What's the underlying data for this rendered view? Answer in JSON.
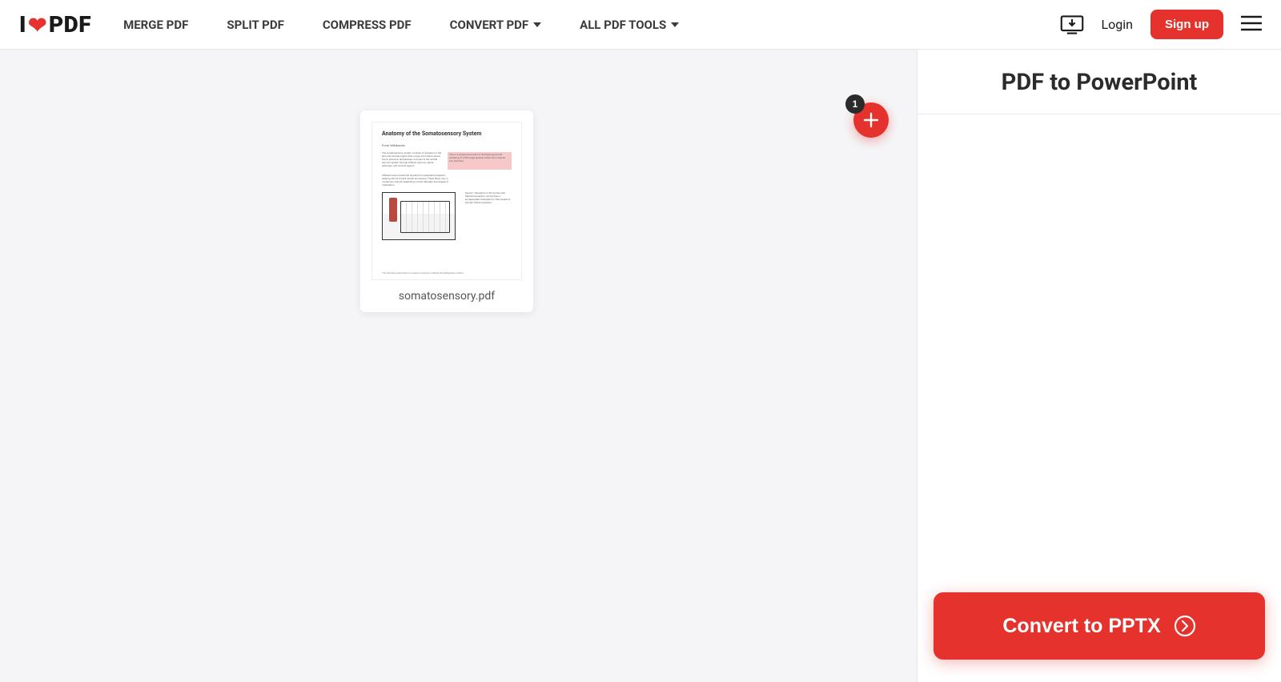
{
  "brand": {
    "pre": "I",
    "post": "PDF"
  },
  "nav": {
    "merge": "MERGE PDF",
    "split": "SPLIT PDF",
    "compress": "COMPRESS PDF",
    "convert": "CONVERT PDF",
    "all": "ALL PDF TOOLS"
  },
  "header": {
    "login": "Login",
    "signup": "Sign up"
  },
  "sidebar": {
    "title": "PDF to PowerPoint",
    "cta": "Convert to PPTX"
  },
  "file": {
    "name": "somatosensory.pdf",
    "preview_title": "Anatomy of the Somatosensory System"
  },
  "add": {
    "count": "1"
  },
  "colors": {
    "accent": "#e5322d"
  }
}
